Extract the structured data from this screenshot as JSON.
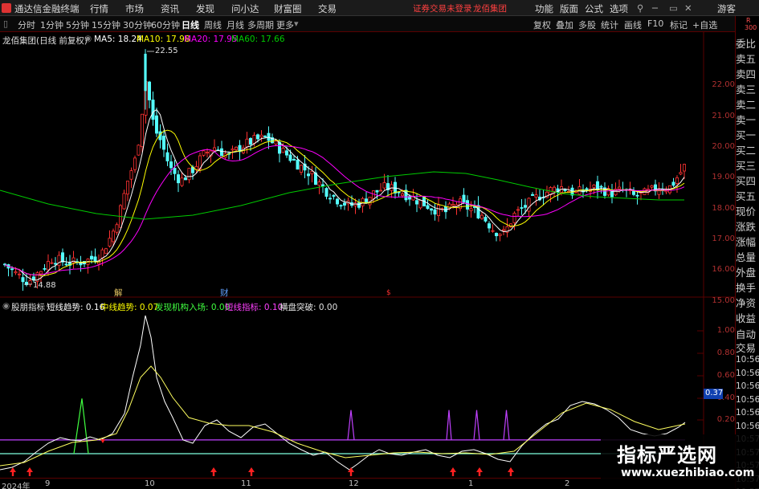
{
  "menubar": {
    "app_title": "通达信金融终端",
    "items": [
      "行情",
      "市场",
      "资讯",
      "发现",
      "问小达",
      "财富圈",
      "交易"
    ],
    "notice": "证券交易未登录",
    "stock_name": "龙佰集团",
    "right_items": [
      "功能",
      "版面",
      "公式",
      "选项"
    ],
    "guest": "游客"
  },
  "toolbar": {
    "periods": [
      "分时",
      "1分钟",
      "5分钟",
      "15分钟",
      "30分钟",
      "60分钟",
      "日线",
      "周线",
      "月线",
      "多周期",
      "更多"
    ],
    "active_period": "日线",
    "right_buttons": [
      "复权",
      "叠加",
      "多股",
      "统计",
      "画线",
      "F10",
      "标记",
      "+自选"
    ]
  },
  "main_chart": {
    "title": "龙佰集团(日线 前复权)",
    "ma_labels": [
      "MA5: 18.24",
      "MA10: 17.98",
      "MA20: 17.95",
      "MA60: 17.66"
    ],
    "high_label": "22.55",
    "low_label": "14.88",
    "y_ticks": [
      "22.00",
      "21.00",
      "20.00",
      "19.00",
      "18.00",
      "17.00",
      "16.00",
      "15.00"
    ],
    "markers": [
      "解",
      "财",
      "$"
    ]
  },
  "indicator": {
    "name": "股朋指标",
    "labels": [
      "短线趋势: 0.16",
      "中线趋势: 0.07",
      "发现机构入场: 0.00",
      "短线指标: 0.10",
      "横盘突破: 0.00"
    ],
    "y_ticks": [
      "1.00",
      "0.80",
      "0.60",
      "0.40",
      "0.20"
    ],
    "cursor_value": "0.37"
  },
  "x_axis": [
    "2024年",
    "9",
    "10",
    "11",
    "12",
    "1",
    "2"
  ],
  "right_panel": {
    "header": [
      "R",
      "300"
    ],
    "items": [
      "委比",
      "卖五",
      "卖四",
      "卖三",
      "卖二",
      "卖一",
      "买一",
      "买二",
      "买三",
      "买四",
      "买五",
      "现价",
      "涨跌",
      "涨幅",
      "总量",
      "外盘",
      "换手",
      "净资",
      "收益",
      "自动",
      "交易",
      "10:56",
      "10:56",
      "10:56",
      "10:56",
      "10:56",
      "10:56",
      "10:57",
      "10:57",
      "10:57",
      "10:57",
      "10:57"
    ]
  },
  "watermark": {
    "title": "指标严选网",
    "url": "www.xuezhibiao.com"
  },
  "colors": {
    "up": "#ff3232",
    "down": "#54ffff",
    "ma5": "#ffffff",
    "ma10": "#ffff00",
    "ma20": "#ff00ff",
    "ma60": "#00cc00"
  }
}
